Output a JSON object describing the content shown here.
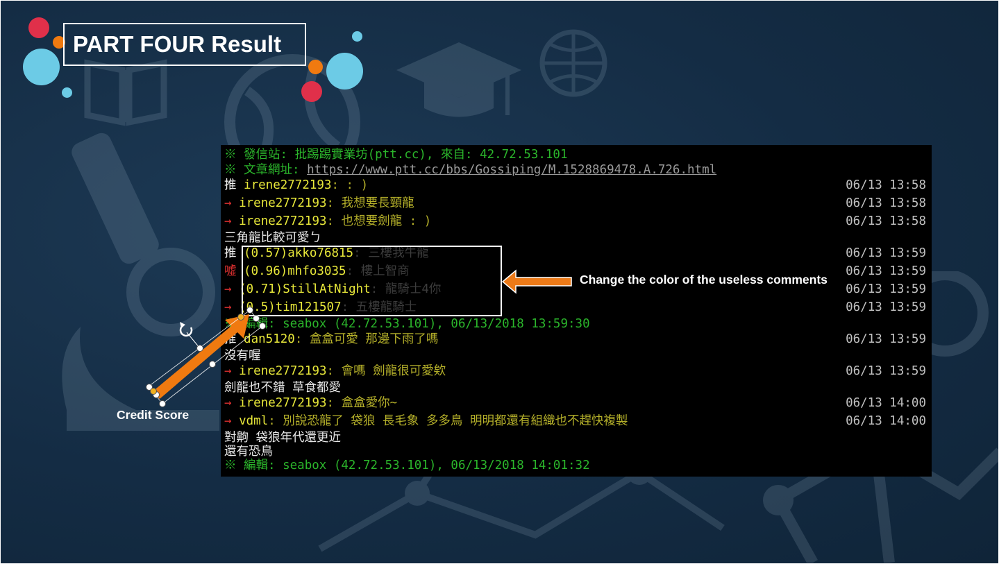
{
  "slide": {
    "title": "PART FOUR Result",
    "callout_text": "Change the color of the useless comments",
    "credit_label": "Credit Score",
    "accent_colors": {
      "orange": "#f07a10",
      "red": "#e0304a",
      "blue": "#6ccbe6",
      "background": "#142c44"
    },
    "icons": [
      "book-icon",
      "graduation-cap-icon",
      "globe-icon",
      "microscope-icon",
      "network-icon"
    ]
  },
  "terminal": {
    "header": [
      {
        "prefix": "※",
        "label": "發信站:",
        "value": "批踢踢實業坊(ptt.cc), 來自: 42.72.53.101"
      },
      {
        "prefix": "※",
        "label": "文章網址:",
        "value": "https://www.ptt.cc/bbs/Gossiping/M.1528869478.A.726.html"
      }
    ],
    "comments": [
      {
        "tag": "推",
        "user": "irene2772193",
        "text": ": : )",
        "time": "06/13 13:58"
      },
      {
        "tag": "→",
        "user": "irene2772193",
        "text": ": 我想要長頸龍",
        "time": "06/13 13:58"
      },
      {
        "tag": "→",
        "user": "irene2772193",
        "text": ": 也想要劍龍 : )",
        "time": "06/13 13:58"
      },
      {
        "plain": "三角龍比較可愛ㄅ"
      },
      {
        "tag": "推",
        "user": "(0.57)akko76815",
        "text": ": 三樓我牛龍",
        "time": "06/13 13:59"
      },
      {
        "tag": "噓",
        "user": "(0.96)mhfo3035",
        "text": ": 樓上智商",
        "time": "06/13 13:59"
      },
      {
        "tag": "→",
        "user": "(0.71)StillAtNight",
        "text": ": 龍騎士4你",
        "time": "06/13 13:59"
      },
      {
        "tag": "→",
        "user": "(0.5)tim121507",
        "text": ": 五樓龍騎士",
        "time": "06/13 13:59"
      },
      {
        "edit": "※ 編輯: seabox (42.72.53.101), 06/13/2018 13:59:30"
      },
      {
        "tag": "推",
        "user": "dan5120",
        "text": ": 盒盒可愛  那邊下雨了嗎",
        "time": "06/13 13:59"
      },
      {
        "plain": "沒有喔"
      },
      {
        "tag": "→",
        "user": "irene2772193",
        "text": ": 會嗎  劍龍很可愛欸",
        "time": "06/13 13:59"
      },
      {
        "plain": "劍龍也不錯 草食都愛"
      },
      {
        "tag": "→",
        "user": "irene2772193",
        "text": ": 盒盒愛你~",
        "time": "06/13 14:00"
      },
      {
        "tag": "→",
        "user": "vdml",
        "text": ": 別說恐龍了  袋狼  長毛象  多多鳥  明明都還有組織也不趕快複製",
        "time": "06/13 14:00"
      },
      {
        "plain": "對齁 袋狼年代還更近"
      },
      {
        "plain": "還有恐鳥"
      },
      {
        "edit": "※ 編輯: seabox (42.72.53.101), 06/13/2018 14:01:32"
      }
    ]
  }
}
